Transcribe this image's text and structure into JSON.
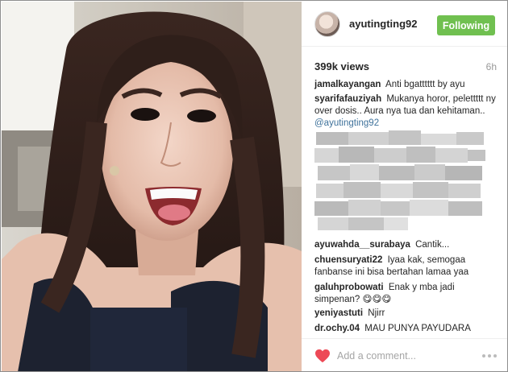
{
  "post": {
    "username": "ayutingting92",
    "follow_label": "Following",
    "views": "399k views",
    "time": "6h"
  },
  "comments": [
    {
      "author": "jamalkayangan",
      "text": "Anti bgatttttt by ayu"
    },
    {
      "author": "syarifafauziyah",
      "text": "Mukanya horor, pelettttt ny over dosis.. Aura nya tua dan kehitaman..",
      "mention": "@ayutingting92"
    },
    {
      "author": "ayuwahda__surabaya",
      "text": "Cantik..."
    },
    {
      "author": "chuensuryati22",
      "text": "Iyaa kak, semogaa fanbanse ini bisa bertahan lamaa yaa"
    },
    {
      "author": "galuhprobowati",
      "text": "Enak y mba jadi simpenan? 😋😋😋"
    },
    {
      "author": "yeniyastuti",
      "text": "Njirr"
    },
    {
      "author": "dr.ochy.04",
      "text": "MAU PUNYA PAYUDARA"
    }
  ],
  "footer": {
    "add_comment_placeholder": "Add a comment..."
  },
  "icons": {
    "like": "heart-icon",
    "more": "more-options-icon",
    "avatar": "avatar"
  },
  "colors": {
    "follow_button": "#70c050",
    "heart": "#ed4956",
    "mention": "#3f729b"
  }
}
